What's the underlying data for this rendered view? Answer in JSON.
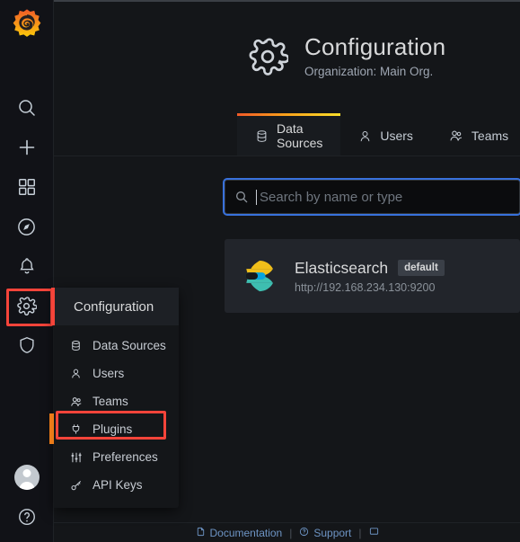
{
  "brand": {
    "logo_icon": "grafana-logo-icon"
  },
  "sidebar": {
    "top_items": [
      {
        "icon": "search-icon",
        "name": "search"
      },
      {
        "icon": "plus-icon",
        "name": "create"
      },
      {
        "icon": "dashboards-grid-icon",
        "name": "dashboards"
      },
      {
        "icon": "compass-explore-icon",
        "name": "explore"
      },
      {
        "icon": "bell-alerting-icon",
        "name": "alerting"
      },
      {
        "icon": "gear-configuration-icon",
        "name": "configuration"
      },
      {
        "icon": "shield-server-admin-icon",
        "name": "server-admin"
      }
    ],
    "bottom_items": [
      {
        "icon": "user-avatar-icon",
        "name": "profile"
      },
      {
        "icon": "help-question-icon",
        "name": "help"
      }
    ]
  },
  "header": {
    "icon": "gear-icon",
    "title": "Configuration",
    "subtitle": "Organization: Main Org."
  },
  "tabs": [
    {
      "label": "Data Sources",
      "icon": "database-icon",
      "active": true
    },
    {
      "label": "Users",
      "icon": "user-icon",
      "active": false
    },
    {
      "label": "Teams",
      "icon": "users-icon",
      "active": false
    }
  ],
  "search": {
    "placeholder": "Search by name or type",
    "value": ""
  },
  "datasources": [
    {
      "name": "Elasticsearch",
      "badge": "default",
      "url": "http://192.168.234.130:9200",
      "logo": "elasticsearch-logo-icon"
    }
  ],
  "config_menu": {
    "header": "Configuration",
    "items": [
      {
        "label": "Data Sources",
        "icon": "database-icon",
        "selected": false
      },
      {
        "label": "Users",
        "icon": "user-icon",
        "selected": false
      },
      {
        "label": "Teams",
        "icon": "users-icon",
        "selected": false
      },
      {
        "label": "Plugins",
        "icon": "plug-icon",
        "selected": true
      },
      {
        "label": "Preferences",
        "icon": "sliders-icon",
        "selected": false
      },
      {
        "label": "API Keys",
        "icon": "key-icon",
        "selected": false
      }
    ]
  },
  "footer": {
    "documentation": "Documentation",
    "support": "Support",
    "separator": "|"
  },
  "colors": {
    "accent_orange": "#eb7b18",
    "highlight_red": "#f5443a",
    "focus_blue": "#3871dc",
    "tab_gradient_start": "#f05a28",
    "tab_gradient_end": "#fade2a"
  }
}
